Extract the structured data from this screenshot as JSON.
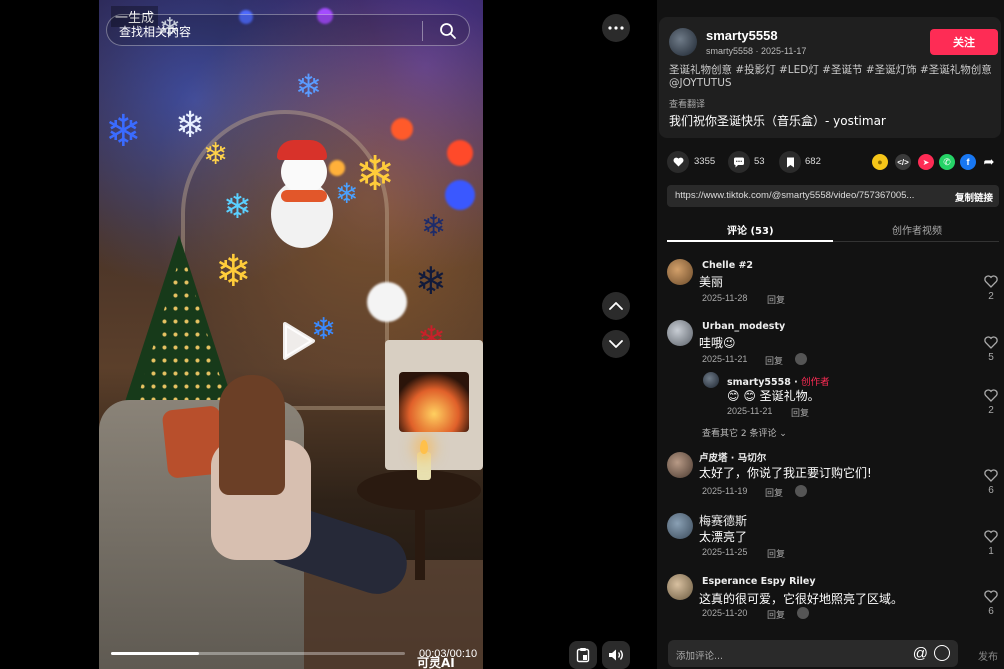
{
  "video": {
    "logo_text": "一生成",
    "search_hint": "查找相关内容",
    "progress": 0.3,
    "time": "00:03/00:10",
    "watermark": "可灵AI"
  },
  "author": {
    "name": "smarty5558",
    "meta": "smarty5558 · 2025-11-17",
    "follow_label": "关注",
    "description": "圣诞礼物创意 #投影灯 #LED灯 #圣诞节 #圣诞灯饰 #圣诞礼物创意 @JOYTUTUS",
    "translate_label": "查看翻译",
    "music": "我们祝你圣诞快乐（音乐盒）- yostimar"
  },
  "stats": {
    "likes": "3355",
    "comments": "53",
    "saves": "682",
    "share_icons": [
      "coin-icon",
      "embed-icon",
      "send-icon",
      "whatsapp-icon",
      "facebook-icon",
      "share-arrow-icon"
    ]
  },
  "link": {
    "url": "https://www.tiktok.com/@smarty5558/video/757367005...",
    "copy_label": "复制链接"
  },
  "tabs": {
    "comments": "评论 (53)",
    "creator_videos": "创作者视频"
  },
  "comments": [
    {
      "name": "Chelle #2",
      "text": "美丽",
      "date": "2025-11-28",
      "reply": "回复",
      "likes": "2"
    },
    {
      "name": "Urban_modesty",
      "text": "哇哦😉",
      "date": "2025-11-21",
      "reply": "回复",
      "likes": "5"
    },
    {
      "name": "smarty5558 · ",
      "badge": "创作者",
      "text": "😊 😊 圣诞礼物。",
      "date": "2025-11-21",
      "reply": "回复",
      "likes": "2"
    },
    {
      "name": "卢皮塔 · 马切尔",
      "text": "太好了，你说了我正要订购它们!",
      "date": "2025-11-19",
      "reply": "回复",
      "likes": "6"
    },
    {
      "name": "梅赛德斯",
      "text": "太漂亮了",
      "date": "2025-11-25",
      "reply": "回复",
      "likes": "1"
    },
    {
      "name": "Esperance Espy Riley",
      "text": "这真的很可爱，它很好地照亮了区域。",
      "date": "2025-11-20",
      "reply": "回复",
      "likes": "6"
    }
  ],
  "more_replies": "查看其它 2 条评论 ⌄",
  "composer": {
    "placeholder": "添加评论...",
    "post_label": "发布"
  },
  "colors": {
    "accent": "#fe2c55",
    "panel_bg": "#121212",
    "card_bg": "#1f1f1f"
  }
}
